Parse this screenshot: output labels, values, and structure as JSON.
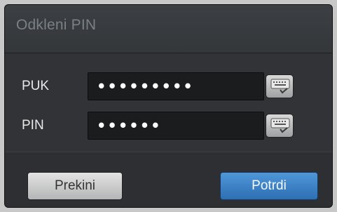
{
  "dialog": {
    "title": "Odkleni PIN"
  },
  "fields": [
    {
      "label": "PUK",
      "value": "•••••••••"
    },
    {
      "label": "PIN",
      "value": "••••••"
    }
  ],
  "icons": {
    "keyboard": "keyboard-icon"
  },
  "buttons": {
    "cancel_label": "Prekini",
    "ok_label": "Potrdi"
  },
  "colors": {
    "accent": "#3a82c6",
    "background": "#313336"
  }
}
